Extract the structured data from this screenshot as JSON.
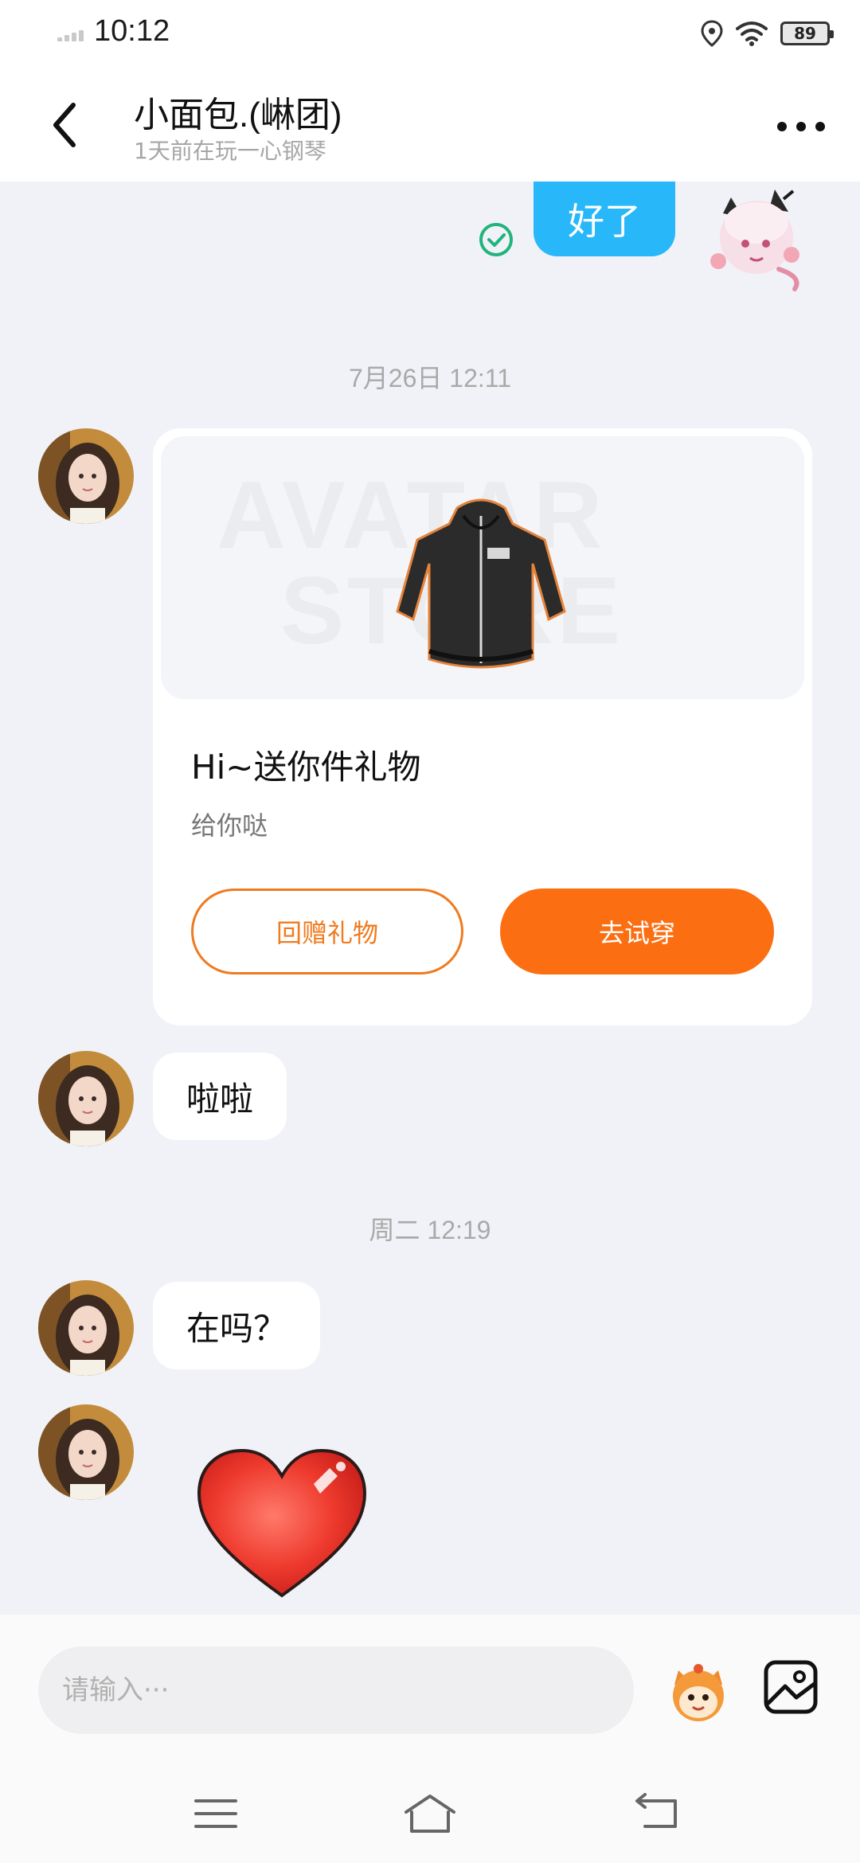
{
  "status_bar": {
    "time": "10:12",
    "battery": "89"
  },
  "header": {
    "title": "小面包.(崊团)",
    "subtitle": "1天前在玩一心钢琴"
  },
  "messages": {
    "outgoing_text": "好了",
    "timestamp_1": "7月26日 12:11",
    "gift_card": {
      "watermark_line1": "AVATAR",
      "watermark_line2": "STORE",
      "title": "Hi~送你件礼物",
      "description": "给你哒",
      "return_button": "回赠礼物",
      "try_button": "去试穿"
    },
    "incoming_1": "啦啦",
    "timestamp_2": "周二 12:19",
    "incoming_2": "在吗？"
  },
  "input": {
    "placeholder": "请输入···"
  },
  "colors": {
    "accent_orange": "#fb6f12",
    "bubble_blue": "#28b8f9",
    "check_green": "#21b47c"
  }
}
